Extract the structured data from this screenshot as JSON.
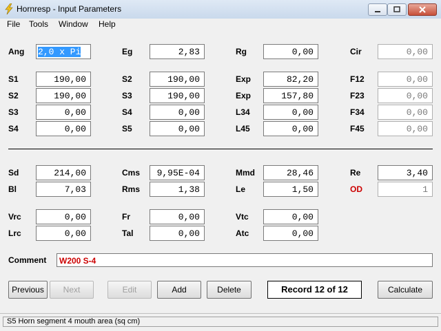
{
  "window": {
    "title": "Hornresp - Input Parameters"
  },
  "menu": [
    {
      "label": "File"
    },
    {
      "label": "Tools"
    },
    {
      "label": "Window"
    },
    {
      "label": "Help"
    }
  ],
  "labels": {
    "ang": "Ang",
    "eg": "Eg",
    "rg": "Rg",
    "cir": "Cir",
    "s1a": "S1",
    "s2b": "S2",
    "exp1": "Exp",
    "f12": "F12",
    "s2a": "S2",
    "s3b": "S3",
    "exp2": "Exp",
    "f23": "F23",
    "s3a": "S3",
    "s4b": "S4",
    "l34": "L34",
    "f34": "F34",
    "s4a": "S4",
    "s5b": "S5",
    "l45": "L45",
    "f45": "F45",
    "sd": "Sd",
    "cms": "Cms",
    "mmd": "Mmd",
    "re": "Re",
    "bl": "Bl",
    "rms": "Rms",
    "le": "Le",
    "od": "OD",
    "vrc": "Vrc",
    "fr": "Fr",
    "vtc": "Vtc",
    "lrc": "Lrc",
    "tal": "Tal",
    "atc": "Atc",
    "comment": "Comment"
  },
  "values": {
    "ang": "2,0 x Pi",
    "eg": "2,83",
    "rg": "0,00",
    "cir": "0,00",
    "s1a": "190,00",
    "s2b": "190,00",
    "exp1": "82,20",
    "f12": "0,00",
    "s2a": "190,00",
    "s3b": "190,00",
    "exp2": "157,80",
    "f23": "0,00",
    "s3a": "0,00",
    "s4b": "0,00",
    "l34": "0,00",
    "f34": "0,00",
    "s4a": "0,00",
    "s5b": "0,00",
    "l45": "0,00",
    "f45": "0,00",
    "sd": "214,00",
    "cms": "9,95E-04",
    "mmd": "28,46",
    "re": "3,40",
    "bl": "7,03",
    "rms": "1,38",
    "le": "1,50",
    "od": "1",
    "vrc": "0,00",
    "fr": "0,00",
    "vtc": "0,00",
    "lrc": "0,00",
    "tal": "0,00",
    "atc": "0,00",
    "comment": "W200 S-4"
  },
  "buttons": {
    "previous": "Previous",
    "next": "Next",
    "edit": "Edit",
    "add": "Add",
    "delete": "Delete",
    "calculate": "Calculate"
  },
  "record": "Record 12 of 12",
  "status": "S5   Horn segment 4 mouth area  (sq cm)",
  "colors": {
    "highlight": "#3399ff",
    "red_text": "#cc0000"
  }
}
